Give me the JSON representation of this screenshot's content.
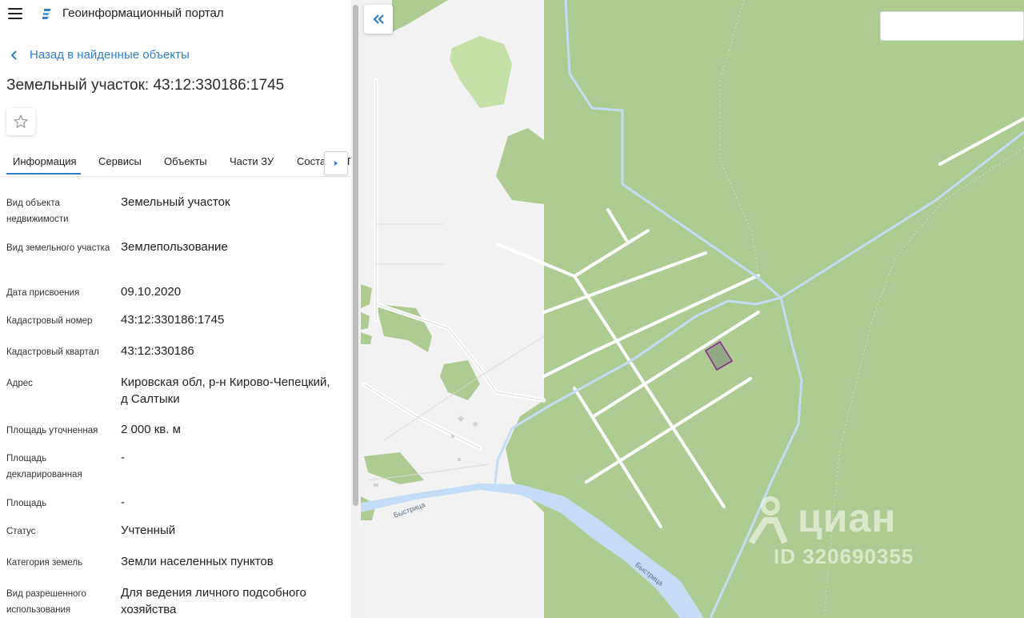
{
  "app": {
    "title": "Геоинформационный портал"
  },
  "nav": {
    "back_label": "Назад в найденные объекты"
  },
  "object": {
    "title": "Земельный участок: 43:12:330186:1745"
  },
  "tabs": [
    {
      "label": "Информация",
      "active": true
    },
    {
      "label": "Сервисы"
    },
    {
      "label": "Объекты"
    },
    {
      "label": "Части ЗУ"
    },
    {
      "label": "Соста"
    }
  ],
  "tab_overflow_text": "Г",
  "properties": [
    {
      "label": "Вид объекта недвижимости",
      "value": "Земельный участок"
    },
    {
      "label": "Вид земельного участка",
      "value": "Землепользование"
    },
    {
      "label": "Дата присвоения",
      "value": "09.10.2020"
    },
    {
      "label": "Кадастровый номер",
      "value": "43:12:330186:1745"
    },
    {
      "label": "Кадастровый квартал",
      "value": "43:12:330186"
    },
    {
      "label": "Адрес",
      "value": "Кировская обл, р-н Кирово-Чепецкий, д Салтыки"
    },
    {
      "label": "Площадь уточненная",
      "value": "2 000 кв. м"
    },
    {
      "label": "Площадь декларированная",
      "value": "-"
    },
    {
      "label": "Площадь",
      "value": "-"
    },
    {
      "label": "Статус",
      "value": "Учтенный"
    },
    {
      "label": "Категория земель",
      "value": "Земли населенных пунктов"
    },
    {
      "label": "Вид разрешенного использования",
      "value": "Для ведения личного подсобного хозяйства"
    }
  ],
  "map": {
    "search_value": "",
    "river_labels": [
      "Быстрица",
      "Быстрица"
    ],
    "watermark": {
      "name": "циан",
      "id": "ID 320690355"
    },
    "colors": {
      "forest": "#aecb91",
      "water": "#c4dcf5",
      "road": "#ffffff",
      "parcel_stroke": "#8a2d8e",
      "parcel_fill": "#8f9f83"
    }
  },
  "icons": {
    "menu": "hamburger-icon",
    "logo": "portal-logo-icon",
    "back": "chevron-left-icon",
    "favorite": "star-icon",
    "tab_scroll": "caret-right-icon",
    "collapse": "double-chevron-left-icon"
  }
}
